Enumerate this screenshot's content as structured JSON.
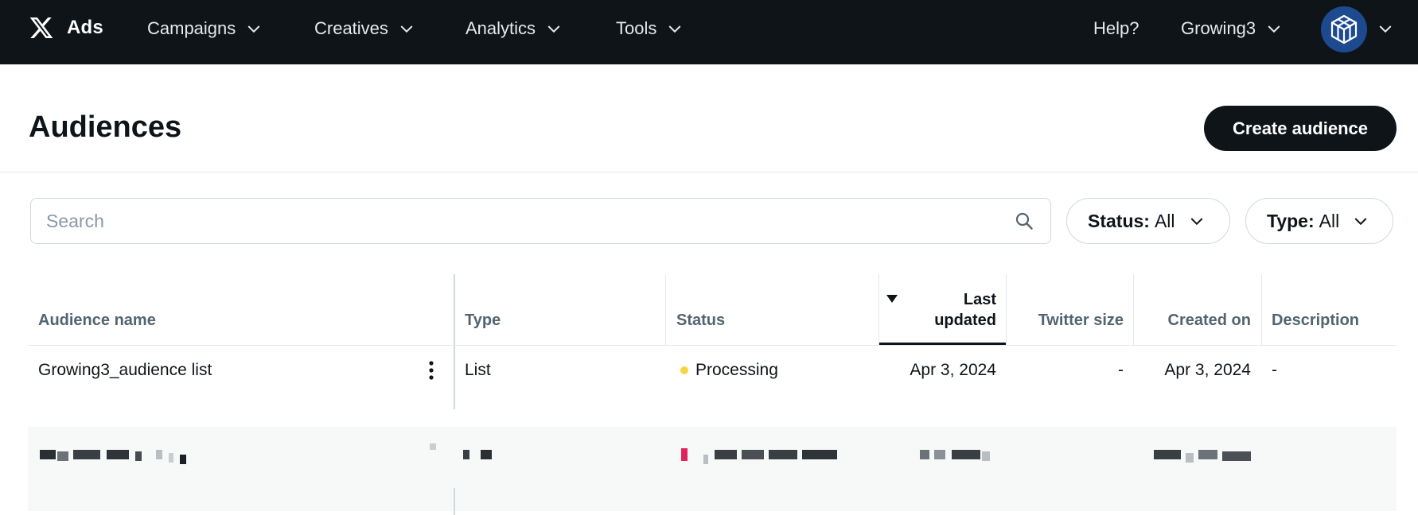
{
  "nav": {
    "brand_label": "Ads",
    "items": [
      {
        "label": "Campaigns"
      },
      {
        "label": "Creatives"
      },
      {
        "label": "Analytics"
      },
      {
        "label": "Tools"
      }
    ],
    "help_label": "Help?",
    "account_label": "Growing3",
    "avatar_icon": "cube-logo-icon"
  },
  "page": {
    "title": "Audiences",
    "create_button_label": "Create audience"
  },
  "filters": {
    "search_placeholder": "Search",
    "search_value": "",
    "status": {
      "key": "Status:",
      "value": "All"
    },
    "type": {
      "key": "Type:",
      "value": "All"
    }
  },
  "table": {
    "columns": {
      "name": "Audience name",
      "type": "Type",
      "status": "Status",
      "last_updated_1": "Last",
      "last_updated_2": "updated",
      "twitter_size": "Twitter size",
      "created_on": "Created on",
      "description": "Description"
    },
    "sort": {
      "column": "last_updated",
      "direction": "descending"
    },
    "rows": [
      {
        "name": "Growing3_audience list",
        "type": "List",
        "status": "Processing",
        "status_color": "#f5d547",
        "last_updated": "Apr 3, 2024",
        "twitter_size": "-",
        "created_on": "Apr 3, 2024",
        "description": "-"
      }
    ]
  },
  "colors": {
    "nav_bg": "#0f1419",
    "primary_button": "#0f1419",
    "error_indicator": "#e0245e"
  }
}
